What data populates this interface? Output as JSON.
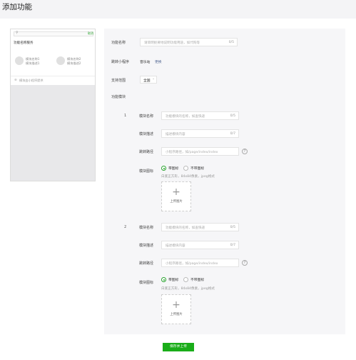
{
  "page": {
    "title": "添加功能"
  },
  "preview": {
    "search_icon": "search-icon",
    "cancel": "取消",
    "title": "功能名称服务",
    "modules": [
      {
        "name": "模块名称1",
        "desc": "模块描述1"
      },
      {
        "name": "模块名称2",
        "desc": "模块描述2"
      }
    ],
    "footer_icon": "miniprogram-icon",
    "footer_text": "模块由小程序提供"
  },
  "form": {
    "feature_name": {
      "label": "功能名称",
      "placeholder": "请简明扼要地说明功能用途，如代购等",
      "count": "0/5"
    },
    "miniprogram": {
      "label": "跳转小程序",
      "value": "音乐站",
      "change": "更换"
    },
    "scope": {
      "label": "支持范围",
      "value": "全国"
    },
    "modules_section": {
      "label": "功能模块"
    },
    "modules": [
      {
        "index": "1",
        "name": {
          "label": "模块名称",
          "placeholder": "功能模块的名称，如查快递",
          "count": "0/5"
        },
        "desc": {
          "label": "模块描述",
          "placeholder": "描述模块内容",
          "count": "0/7"
        },
        "path": {
          "label": "跳转路径",
          "placeholder": "小程序路径，如/page/index/index"
        },
        "icon": {
          "label": "模块图标",
          "opt_with": "带图标",
          "opt_without": "不带图标",
          "hint": "白底正方形，84x84像素，jpeg格式",
          "upload": "上传图片"
        }
      },
      {
        "index": "2",
        "name": {
          "label": "模块名称",
          "placeholder": "功能模块的名称，如查快递",
          "count": "0/5"
        },
        "desc": {
          "label": "模块描述",
          "placeholder": "描述模块内容",
          "count": "0/7"
        },
        "path": {
          "label": "跳转路径",
          "placeholder": "小程序路径，如/page/index/index"
        },
        "icon": {
          "label": "模块图标",
          "opt_with": "带图标",
          "opt_without": "不带图标",
          "hint": "白底正方形，84x84像素，jpeg格式",
          "upload": "上传图片"
        }
      }
    ]
  },
  "actions": {
    "save": "保存并上传"
  },
  "colors": {
    "accent": "#1aad19",
    "link": "#576b95"
  }
}
